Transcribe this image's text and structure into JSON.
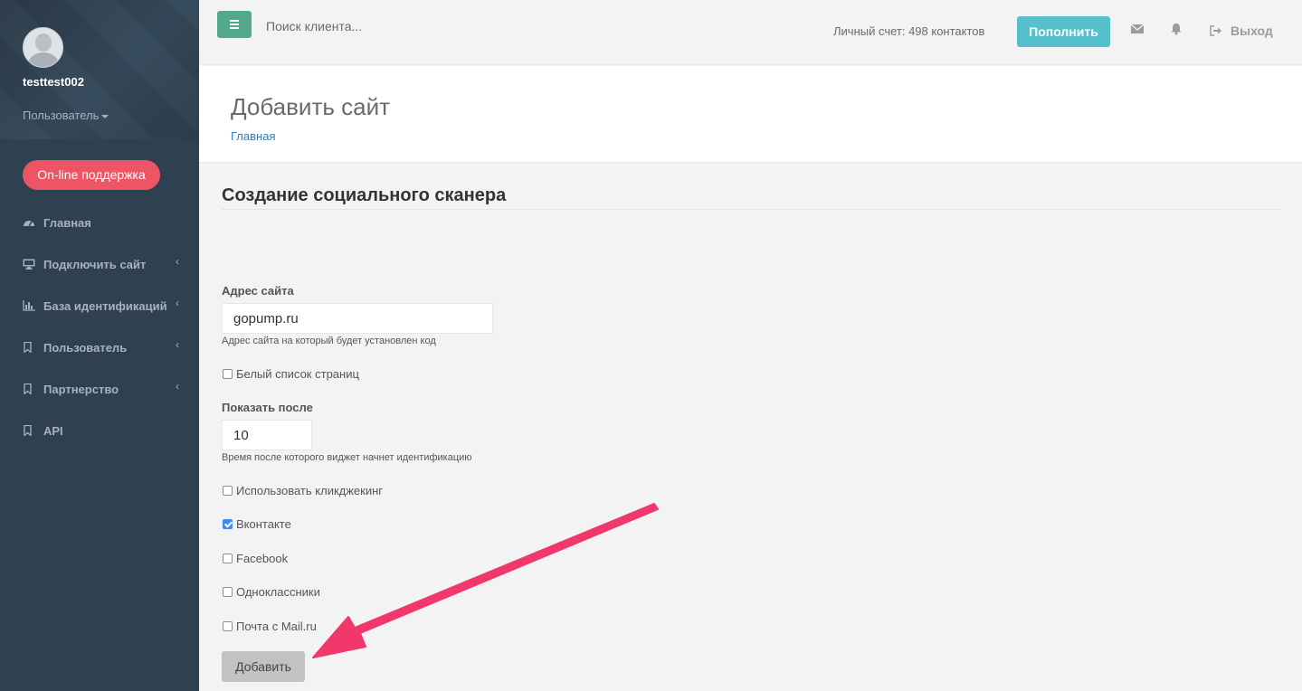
{
  "sidebar": {
    "username": "testtest002",
    "role": "Пользователь",
    "support_button": "On-line поддержка",
    "items": [
      {
        "label": "Главная",
        "icon": "dashboard-icon"
      },
      {
        "label": "Подключить сайт",
        "icon": "monitor-icon",
        "arrow": "‹"
      },
      {
        "label": "База идентификаций",
        "icon": "bar-chart-icon",
        "arrow": "‹"
      },
      {
        "label": "Пользователь",
        "icon": "bookmark-icon",
        "arrow": "‹"
      },
      {
        "label": "Партнерство",
        "icon": "bookmark-icon",
        "arrow": "‹"
      },
      {
        "label": "API",
        "icon": "bookmark-icon"
      }
    ]
  },
  "topbar": {
    "search_placeholder": "Поиск клиента...",
    "account": "Личный счет: 498 контактов",
    "topup_label": "Пополнить",
    "logout_label": "Выход"
  },
  "heading": {
    "title": "Добавить сайт",
    "breadcrumb": "Главная"
  },
  "form": {
    "section_title": "Создание социального сканера",
    "site_label": "Адрес сайта",
    "site_value": "gopump.ru",
    "site_help": "Адрес сайта на который будет установлен код",
    "whitelist_label": "Белый список страниц",
    "show_after_label": "Показать после",
    "show_after_value": "10",
    "show_after_help": "Время после которого виджет начнет идентификацию",
    "clickjacking_label": "Использовать кликджекинг",
    "vk_label": "Вконтакте",
    "facebook_label": "Facebook",
    "ok_label": "Одноклассники",
    "mailru_label": "Почта с Mail.ru",
    "submit_label": "Добавить",
    "checks": {
      "whitelist": false,
      "clickjacking": false,
      "vk": true,
      "facebook": false,
      "ok": false,
      "mailru": false
    }
  },
  "colors": {
    "sidebar": "#2f4050",
    "support": "#ed5565",
    "topup": "#56c0cc",
    "menu_button": "#52a88a",
    "annotation_arrow": "#f0386b"
  }
}
